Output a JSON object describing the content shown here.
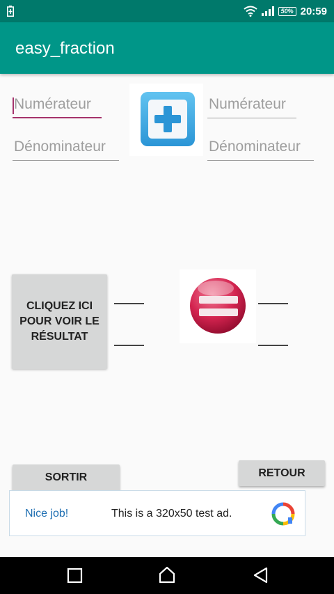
{
  "status_bar": {
    "battery_level": "50%",
    "time": "20:59",
    "icons": [
      "battery-charging-icon",
      "wifi-icon",
      "signal-icon",
      "battery-icon"
    ]
  },
  "app_bar": {
    "title": "easy_fraction"
  },
  "fraction1": {
    "numerator_placeholder": "Numérateur",
    "denominator_placeholder": "Dénominateur"
  },
  "fraction2": {
    "numerator_placeholder": "Numérateur",
    "denominator_placeholder": "Dénominateur"
  },
  "operator_icon": "plus-icon",
  "equals_icon": "equals-icon",
  "result_button": {
    "label": "CLIQUEZ ICI POUR VOIR LE RÉSULTAT"
  },
  "buttons": {
    "exit_label": "SORTIR",
    "back_label": "RETOUR"
  },
  "ad": {
    "headline": "Nice job!",
    "message": "This is a 320x50 test ad."
  },
  "colors": {
    "status_bar": "#00796b",
    "app_bar": "#009688",
    "focus_accent": "#a5336b",
    "button_bg": "#d6d7d7"
  },
  "nav_icons": [
    "recents-icon",
    "home-icon",
    "back-icon"
  ]
}
